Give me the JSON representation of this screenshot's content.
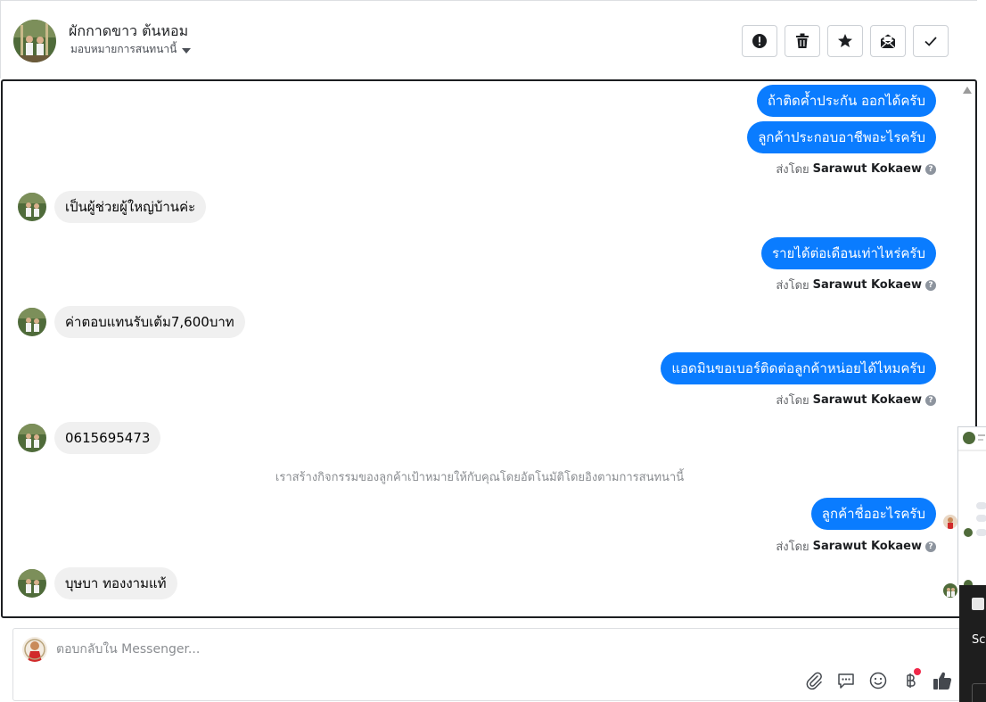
{
  "header": {
    "contact_name": "ผักกาดขาว ต้นหอม",
    "assign_label": "มอบหมายการสนทนานี้",
    "actions": [
      {
        "name": "mark-spam-button",
        "icon": "alert-icon"
      },
      {
        "name": "delete-button",
        "icon": "trash-icon"
      },
      {
        "name": "star-button",
        "icon": "star-icon"
      },
      {
        "name": "mark-unread-button",
        "icon": "envelope-icon"
      },
      {
        "name": "mark-done-button",
        "icon": "check-icon"
      }
    ]
  },
  "thread": {
    "sent_by_prefix": "ส่งโดย",
    "sent_by_name": "Sarawut Kokaew",
    "messages": [
      {
        "text": "ถ้าติดค้ำประกัน ออกได้ครับ"
      },
      {
        "text": "ลูกค้าประกอบอาชีพอะไรครับ"
      },
      {
        "text": "เป็นผู้ช่วยผู้ใหญ่บ้านค่ะ"
      },
      {
        "text": "รายได้ต่อเดือนเท่าไหร่ครับ"
      },
      {
        "text": "ค่าตอบแทนรับเต้ม7,600บาท"
      },
      {
        "text": "แอดมินขอเบอร์ติดต่อลูกค้าหน่อยได้ไหมครับ"
      },
      {
        "text": "0615695473"
      },
      {
        "text": "ลูกค้าชื่ออะไรครับ"
      },
      {
        "text": "บุษบา ทองงามแท้"
      }
    ],
    "system_message": "เราสร้างกิจกรรมของลูกค้าเป้าหมายให้กับคุณโดยอัตโนมัติโดยอิงตามการสนทนานี้"
  },
  "composer": {
    "placeholder": "ตอบกลับใน Messenger..."
  },
  "side_panel": {
    "text": "Scr Au"
  },
  "colors": {
    "outgoing": "#0a7cff",
    "incoming": "#f0f0f0",
    "like": "#0a7cff"
  }
}
